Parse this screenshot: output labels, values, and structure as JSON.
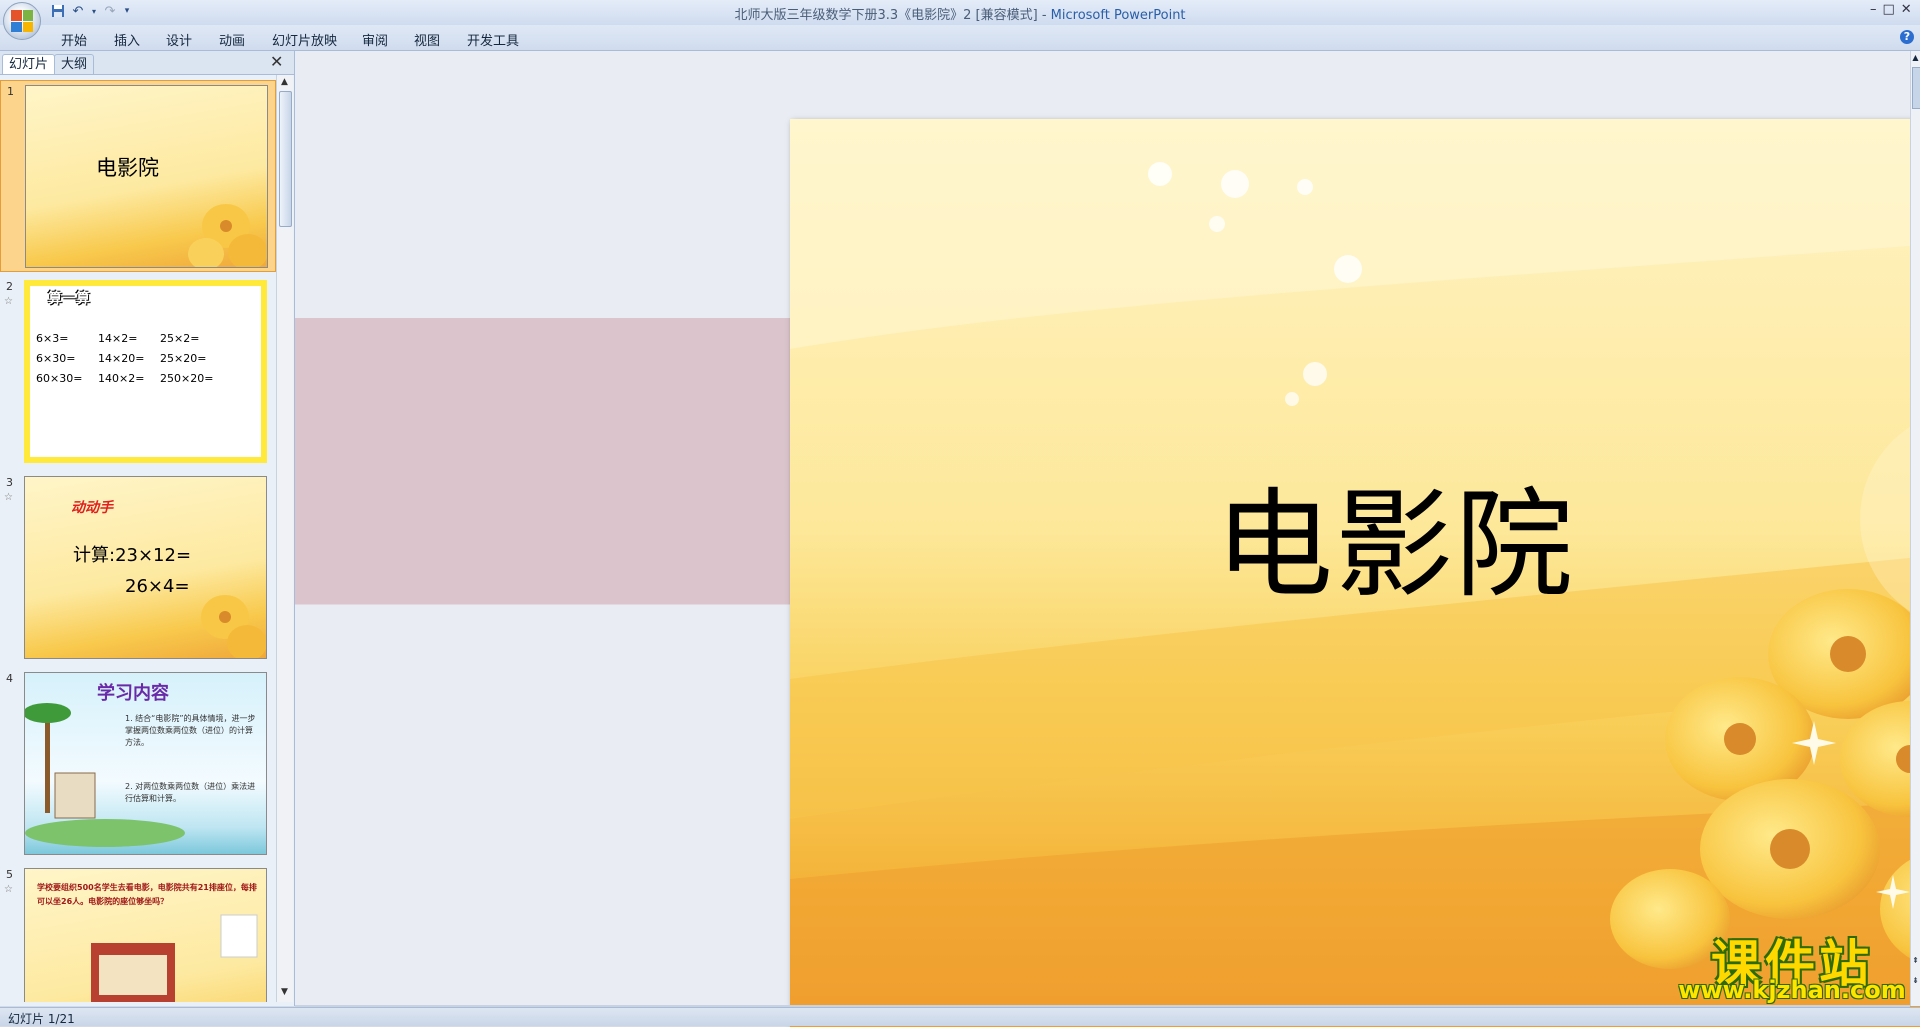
{
  "window": {
    "title": "北师大版三年级数学下册3.3《电影院》2 [兼容模式]",
    "app_name": "Microsoft PowerPoint",
    "controls": [
      "–",
      "□",
      "✕"
    ],
    "help_label": "?"
  },
  "quick_access": {
    "save_icon": "save-icon",
    "undo_icon": "undo-icon",
    "redo_icon": "redo-icon",
    "customize_icon": "customize-icon"
  },
  "ribbon": {
    "tabs": [
      "开始",
      "插入",
      "设计",
      "动画",
      "幻灯片放映",
      "审阅",
      "视图",
      "开发工具"
    ]
  },
  "panel": {
    "tabs": [
      "幻灯片",
      "大纲"
    ],
    "close_label": "✕"
  },
  "thumbnails": [
    {
      "number": "1",
      "title": "电影院"
    },
    {
      "number": "2",
      "heading": "算一算",
      "rows": [
        [
          "6×3=",
          "14×2=",
          "25×2="
        ],
        [
          "6×30=",
          "14×20=",
          "25×20="
        ],
        [
          "60×30=",
          "140×2=",
          "250×20="
        ]
      ]
    },
    {
      "number": "3",
      "heading": "动动手",
      "line1": "计算:23×12=",
      "line2": "26×4="
    },
    {
      "number": "4",
      "heading": "学习内容",
      "items": [
        "1. 结合“电影院”的具体情境，进一步掌握两位数乘两位数（进位）的计算方法。",
        "2. 对两位数乘两位数（进位）乘法进行估算和计算。"
      ]
    },
    {
      "number": "5",
      "text": "学校要组织500名学生去看电影，电影院共有21排座位，每排可以坐26人。电影院的座位够坐吗？"
    }
  ],
  "slide": {
    "title": "电影院"
  },
  "status_bar": {
    "slide_info": "幻灯片 1/21"
  },
  "watermark": {
    "line1": "课件站",
    "line2": "www.kjzhan.com"
  },
  "colors": {
    "selected_thumb": "#fcd48c",
    "slide_bg": "#fde9a0",
    "accent": "#2a5ea8"
  }
}
